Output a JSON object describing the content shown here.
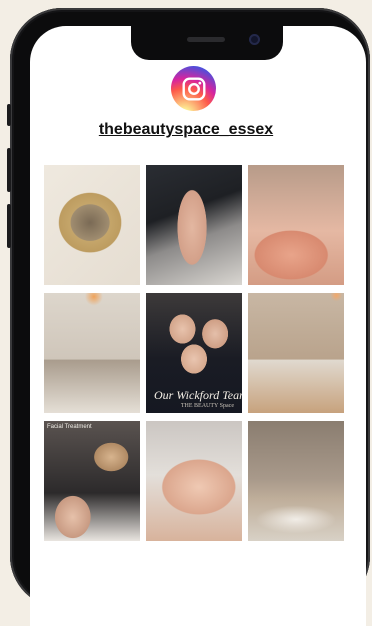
{
  "profile": {
    "handle": "thebeautyspace_essex"
  },
  "icons": {
    "instagram": "instagram-icon"
  },
  "posts": [
    {
      "name": "post-gold-bowl"
    },
    {
      "name": "post-hand-ring"
    },
    {
      "name": "post-back-massage"
    },
    {
      "name": "post-treatment-room"
    },
    {
      "name": "post-team-photo",
      "caption": "Our Wickford Team",
      "subcaption": "THE BEAUTY Space"
    },
    {
      "name": "post-treatment-bed"
    },
    {
      "name": "post-facial-treatment",
      "top_caption": "Facial Treatment"
    },
    {
      "name": "post-face-closeup"
    },
    {
      "name": "post-room-bed"
    }
  ],
  "colors": {
    "background": "#f3eee5",
    "phone_frame": "#0c0c0d",
    "screen": "#ffffff"
  }
}
